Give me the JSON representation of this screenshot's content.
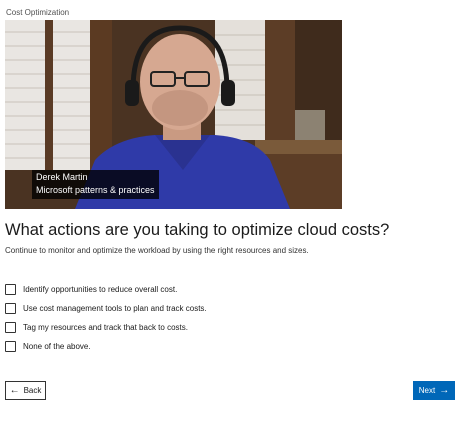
{
  "breadcrumb": "Cost Optimization",
  "video": {
    "caption_name": "Derek Martin",
    "caption_org": "Microsoft patterns & practices"
  },
  "question": {
    "title": "What actions are you taking to optimize cloud costs?",
    "subtitle": "Continue to monitor and optimize the workload by using the right resources and sizes."
  },
  "options": [
    {
      "label": "Identify opportunities to reduce overall cost.",
      "checked": false
    },
    {
      "label": "Use cost management tools to plan and track costs.",
      "checked": false
    },
    {
      "label": "Tag my resources and track that back to costs.",
      "checked": false
    },
    {
      "label": "None of the above.",
      "checked": false
    }
  ],
  "navigation": {
    "back_label": "Back",
    "next_label": "Next",
    "back_icon": "arrow-left-icon",
    "next_icon": "arrow-right-icon"
  },
  "colors": {
    "accent": "#0067b8",
    "text": "#1b1b1b"
  }
}
